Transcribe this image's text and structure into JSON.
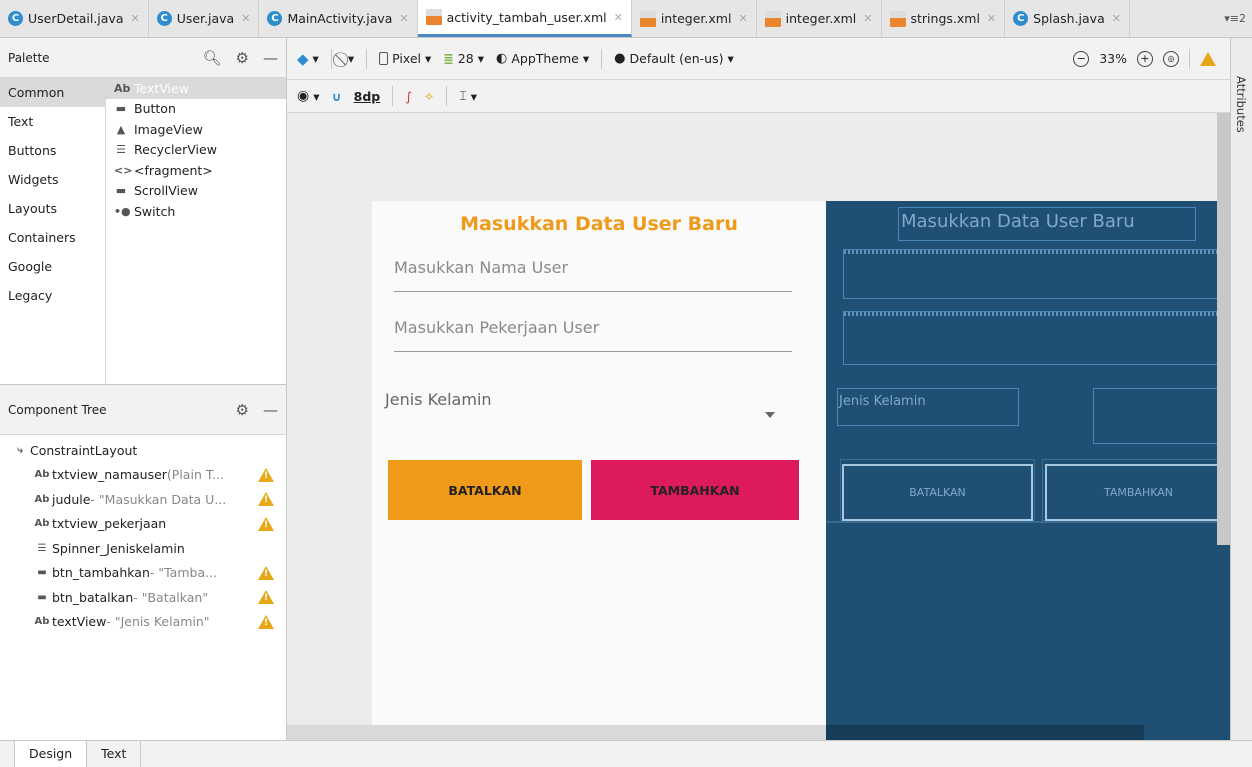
{
  "tabs": [
    {
      "label": "UserDetail.java",
      "icon": "class-icon",
      "active": false
    },
    {
      "label": "User.java",
      "icon": "class-icon",
      "active": false
    },
    {
      "label": "MainActivity.java",
      "icon": "class-icon",
      "active": false
    },
    {
      "label": "activity_tambah_user.xml",
      "icon": "xml-file-icon",
      "active": true
    },
    {
      "label": "integer.xml",
      "icon": "xml-file-icon",
      "active": false
    },
    {
      "label": "integer.xml",
      "icon": "xml-file-icon",
      "active": false
    },
    {
      "label": "strings.xml",
      "icon": "xml-file-icon",
      "active": false
    },
    {
      "label": "Splash.java",
      "icon": "class-icon",
      "active": false
    }
  ],
  "tab_overflow": "▾≡2",
  "palette": {
    "title": "Palette",
    "categories": [
      "Common",
      "Text",
      "Buttons",
      "Widgets",
      "Layouts",
      "Containers",
      "Google",
      "Legacy"
    ],
    "items": [
      {
        "glyph": "Ab",
        "label": "TextView"
      },
      {
        "glyph": "▬",
        "label": "Button"
      },
      {
        "glyph": "▲",
        "label": "ImageView"
      },
      {
        "glyph": "☰",
        "label": "RecyclerView"
      },
      {
        "glyph": "<>",
        "label": "<fragment>"
      },
      {
        "glyph": "▬",
        "label": "ScrollView"
      },
      {
        "glyph": "•●",
        "label": "Switch"
      }
    ]
  },
  "tree": {
    "title": "Component Tree",
    "nodes": [
      {
        "glyph": "⤷",
        "name": "ConstraintLayout",
        "detail": "",
        "indent": 0,
        "warn": false
      },
      {
        "glyph": "Ab",
        "name": "txtview_namauser",
        "detail": "(Plain T...",
        "indent": 1,
        "warn": true
      },
      {
        "glyph": "Ab",
        "name": "judule",
        "detail": "- \"Masukkan Data U...",
        "indent": 1,
        "warn": true
      },
      {
        "glyph": "Ab",
        "name": "txtview_pekerjaan",
        "detail": "",
        "indent": 1,
        "warn": true
      },
      {
        "glyph": "☰",
        "name": "Spinner_Jeniskelamin",
        "detail": "",
        "indent": 1,
        "warn": false
      },
      {
        "glyph": "▬",
        "name": "btn_tambahkan",
        "detail": "- \"Tamba...",
        "indent": 1,
        "warn": true
      },
      {
        "glyph": "▬",
        "name": "btn_batalkan",
        "detail": "- \"Batalkan\"",
        "indent": 1,
        "warn": true
      },
      {
        "glyph": "Ab",
        "name": "textView",
        "detail": "- \"Jenis Kelamin\"",
        "indent": 1,
        "warn": true
      }
    ]
  },
  "toolbar": {
    "device": "Pixel",
    "api": "28",
    "theme": "AppTheme",
    "locale": "Default (en-us)",
    "zoom": "33%",
    "margin": "8dp"
  },
  "attributes_label": "Attributes",
  "design": {
    "title": "Masukkan Data User Baru",
    "hint_nama": "Masukkan Nama User",
    "hint_pekerjaan": "Masukkan Pekerjaan User",
    "label_gender": "Jenis Kelamin",
    "btn_batal": "BATALKAN",
    "btn_tambah": "TAMBAHKAN"
  },
  "colors": {
    "title": "#ef9a1a",
    "btn_batal": "#ef9a1a",
    "btn_tambah": "#dd1b5b",
    "blueprint_bg": "#1f4f73"
  },
  "bottom_tabs": [
    "Design",
    "Text"
  ]
}
